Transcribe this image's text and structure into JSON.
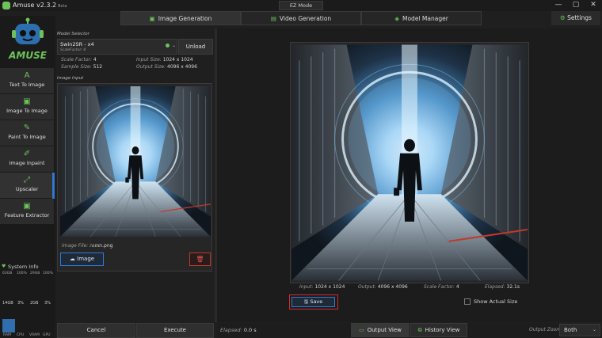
{
  "app": {
    "name": "Amuse v2.3.2",
    "beta": "Beta",
    "mode_button": "EZ Mode",
    "settings": "Settings"
  },
  "tabs": [
    {
      "label": "Image Generation",
      "icon": "image-icon",
      "active": true
    },
    {
      "label": "Video Generation",
      "icon": "film-icon",
      "active": false
    },
    {
      "label": "Model Manager",
      "icon": "layers-icon",
      "active": false
    }
  ],
  "sidebar": {
    "logo_text": "AMUSE",
    "items": [
      {
        "label": "Text To Image",
        "icon": "A"
      },
      {
        "label": "Image To Image",
        "icon": "image-icon"
      },
      {
        "label": "Paint To Image",
        "icon": "brush-icon"
      },
      {
        "label": "Image Inpaint",
        "icon": "edit-icon"
      },
      {
        "label": "Upscaler",
        "icon": "expand-icon",
        "active": true
      },
      {
        "label": "Feature Extractor",
        "icon": "image-icon"
      }
    ]
  },
  "system_info": {
    "title": "System Info",
    "top": [
      "63GB",
      "100%",
      "29GB",
      "100%"
    ],
    "mid": [
      "14GB",
      "3%",
      "2GB",
      "3%"
    ],
    "labels": [
      "RAM",
      "CPU",
      "VRAM",
      "GPU"
    ]
  },
  "model": {
    "section_label": "Model Selector",
    "name": "Swin2SR - x4",
    "scale_factor_sub": "ScaleFactor: 4",
    "unload": "Unload",
    "scale_factor_label": "Scale Factor:",
    "scale_factor_value": "4",
    "sample_size_label": "Sample Size:",
    "sample_size_value": "512",
    "input_size_label": "Input Size:",
    "input_size_value": "1024  x  1024",
    "output_size_label": "Output Size:",
    "output_size_value": "4096  x  4096"
  },
  "image_input": {
    "section_label": "Image Input",
    "file_label": "Image File:",
    "file_name": "תמונה.png",
    "image_button": "Image"
  },
  "actions": {
    "cancel": "Cancel",
    "execute": "Execute"
  },
  "output": {
    "input_label": "Input:",
    "input_value": "1024 x 1024",
    "output_label": "Output:",
    "output_value": "4096 x 4096",
    "scale_label": "Scale Factor:",
    "scale_value": "4",
    "elapsed_label": "Elapsed:",
    "elapsed_value": "32.1s",
    "save": "Save",
    "show_actual_size": "Show Actual Size"
  },
  "status": {
    "elapsed_label": "Elapsed:",
    "elapsed_value": "0.0 s",
    "output_view": "Output View",
    "history_view": "History View",
    "zoom_label": "Output Zoom:",
    "zoom_value": "Both"
  },
  "colors": {
    "accent_green": "#6dc25a",
    "accent_blue": "#2f7ad1",
    "danger_red": "#d8272b"
  }
}
